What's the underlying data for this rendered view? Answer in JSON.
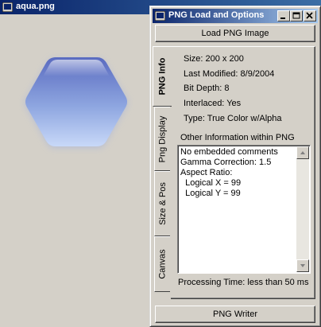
{
  "main_window": {
    "title": "aqua.png"
  },
  "dialog": {
    "title": "PNG Load and Options",
    "load_button": "Load PNG Image",
    "tabs": [
      {
        "label": "PNG Info",
        "active": true
      },
      {
        "label": "Png Display",
        "active": false
      },
      {
        "label": "Size & Pos",
        "active": false
      },
      {
        "label": "Canvas",
        "active": false
      }
    ],
    "info": {
      "size": "Size: 200 x 200",
      "modified": "Last Modified: 8/9/2004",
      "bit_depth": "Bit Depth: 8",
      "interlaced": "Interlaced: Yes",
      "type": "Type: True Color w/Alpha"
    },
    "other_label": "Other Information within PNG",
    "other_lines": [
      "No embedded comments",
      "Gamma Correction: 1.5",
      "Aspect Ratio:",
      "  Logical X = 99",
      "  Logical Y = 99"
    ],
    "processing": "Processing Time: less than 50 ms",
    "writer_button": "PNG Writer"
  },
  "colors": {
    "title_active": "#0a246a",
    "face": "#d4d0c8",
    "hex_fill": "#8c9fdc"
  }
}
